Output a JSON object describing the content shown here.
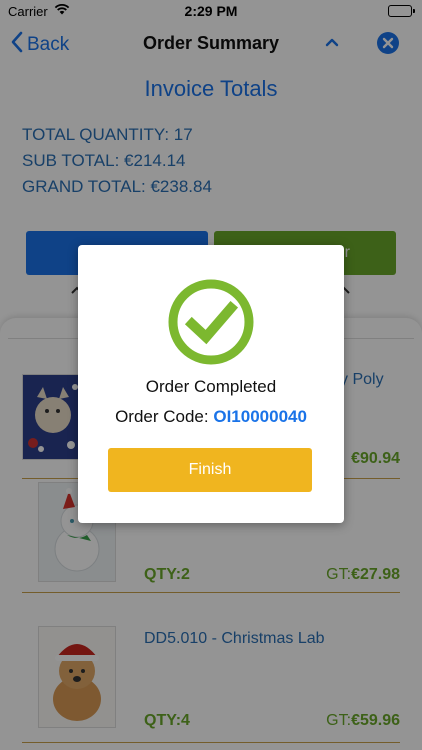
{
  "status_bar": {
    "carrier": "Carrier",
    "time": "2:29 PM"
  },
  "nav": {
    "back_label": "Back",
    "title": "Order Summary"
  },
  "invoice": {
    "heading": "Invoice Totals",
    "total_quantity": "TOTAL QUANTITY: 17",
    "sub_total": "SUB TOTAL: €214.14",
    "grand_total": "GRAND TOTAL: €238.84"
  },
  "buttons": {
    "green_partial_label": "r"
  },
  "items": [
    {
      "name_partial": "y Poly",
      "qty": "",
      "gt_label": "",
      "gt_value": "€90.94"
    },
    {
      "name": "",
      "qty": "QTY:2",
      "gt_label": "GT:",
      "gt_value": "€27.98"
    },
    {
      "name": "DD5.010 - Christmas Lab",
      "qty": "QTY:4",
      "gt_label": "GT:",
      "gt_value": "€59.96"
    }
  ],
  "modal": {
    "message": "Order Completed",
    "code_label": "Order Code:",
    "code_value": "OI10000040",
    "finish_label": "Finish"
  },
  "colors": {
    "accent_blue": "#1a73e8",
    "success_green": "#6aa82a",
    "finish_yellow": "#f0b51f",
    "separator_gold": "#c8a04a"
  },
  "icons": {
    "back": "chevron-left-icon",
    "collapse": "chevron-up-icon",
    "close": "close-circle-icon",
    "success": "check-circle-icon"
  }
}
